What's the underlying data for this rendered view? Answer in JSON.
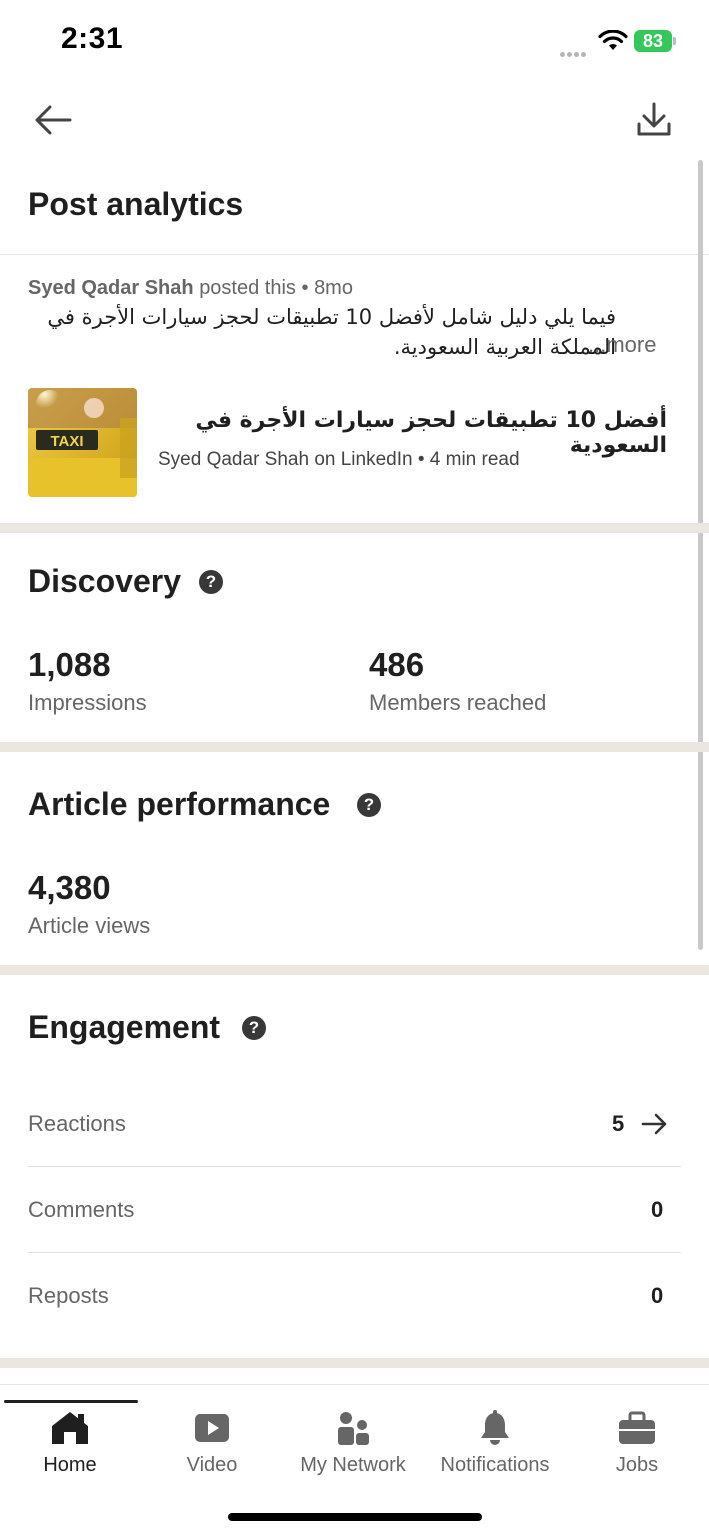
{
  "status_bar": {
    "time": "2:31",
    "battery": "83"
  },
  "page": {
    "title": "Post analytics"
  },
  "post": {
    "author": "Syed Qadar Shah",
    "posted_text": "posted this",
    "separator": "•",
    "age": "8mo",
    "text": "فيما يلي دليل شامل لأفضل 10 تطبيقات لحجز سيارات الأجرة في المملكة العربية السعودية.",
    "more_label": "...more",
    "article": {
      "thumbnail_text": "TAXI",
      "title": "أفضل 10 تطبيقات لحجز سيارات الأجرة في السعودية",
      "subtitle": "Syed Qadar Shah on LinkedIn • 4 min read"
    }
  },
  "discovery": {
    "title": "Discovery",
    "help": "?",
    "stats": [
      {
        "value": "1,088",
        "label": "Impressions"
      },
      {
        "value": "486",
        "label": "Members reached"
      }
    ]
  },
  "article_performance": {
    "title": "Article performance",
    "help": "?",
    "stats": [
      {
        "value": "4,380",
        "label": "Article views"
      }
    ]
  },
  "engagement": {
    "title": "Engagement",
    "help": "?",
    "rows": [
      {
        "label": "Reactions",
        "value": "5"
      },
      {
        "label": "Comments",
        "value": "0"
      },
      {
        "label": "Reposts",
        "value": "0"
      }
    ]
  },
  "bottom_nav": {
    "items": [
      {
        "label": "Home",
        "icon": "home-icon",
        "active": true
      },
      {
        "label": "Video",
        "icon": "video-icon",
        "active": false
      },
      {
        "label": "My Network",
        "icon": "my-network-icon",
        "active": false
      },
      {
        "label": "Notifications",
        "icon": "bell-icon",
        "active": false
      },
      {
        "label": "Jobs",
        "icon": "briefcase-icon",
        "active": false
      }
    ]
  },
  "colors": {
    "text_primary": "#1f1f1f",
    "text_secondary": "#666666",
    "section_divider": "#ebe6e0",
    "battery": "#34c759"
  }
}
